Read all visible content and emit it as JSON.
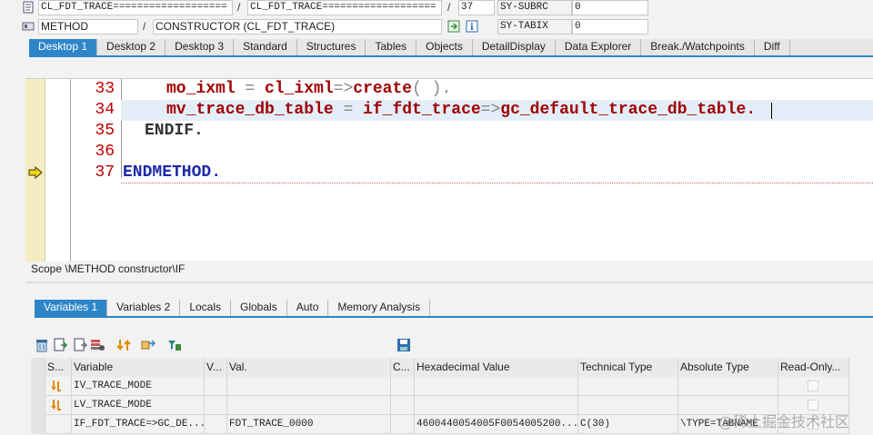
{
  "header": {
    "row1": {
      "field1": "CL_FDT_TRACE===================",
      "sep1": "/",
      "field2": "CL_FDT_TRACE===================",
      "sep2": "/",
      "line_no": "37",
      "sys_label": "SY-SUBRC",
      "sys_value": "0"
    },
    "row2": {
      "type": "METHOD",
      "sep": "/",
      "name": "CONSTRUCTOR (CL_FDT_TRACE)",
      "sys_label": "SY-TABIX",
      "sys_value": "0"
    }
  },
  "desktop_tabs": [
    "Desktop 1",
    "Desktop 2",
    "Desktop 3",
    "Standard",
    "Structures",
    "Tables",
    "Objects",
    "DetailDisplay",
    "Data Explorer",
    "Break./Watchpoints",
    "Diff"
  ],
  "editor": {
    "lines": [
      {
        "num": "33",
        "tokens": [
          {
            "t": "mo_ixml",
            "c": "c-red"
          },
          {
            "t": " = ",
            "c": "c-gray"
          },
          {
            "t": "cl_ixml",
            "c": "c-red"
          },
          {
            "t": "=>",
            "c": "c-gray"
          },
          {
            "t": "create",
            "c": "c-red"
          },
          {
            "t": "( ).",
            "c": "c-gray"
          }
        ]
      },
      {
        "num": "34",
        "tokens": [
          {
            "t": "mv_trace_db_table",
            "c": "c-red"
          },
          {
            "t": " = ",
            "c": "c-gray"
          },
          {
            "t": "if_fdt_trace",
            "c": "c-red"
          },
          {
            "t": "=>",
            "c": "c-gray"
          },
          {
            "t": "gc_default_trace_db_table.",
            "c": "c-red"
          }
        ]
      },
      {
        "num": "35",
        "tokens": [
          {
            "t": "ENDIF.",
            "c": "c-dark"
          }
        ]
      },
      {
        "num": "36",
        "tokens": []
      },
      {
        "num": "37",
        "tokens": [
          {
            "t": "ENDMETHOD.",
            "c": "c-blue"
          }
        ]
      }
    ]
  },
  "scope": "Scope \\METHOD constructor\\IF",
  "var_tabs": [
    "Variables 1",
    "Variables 2",
    "Locals",
    "Globals",
    "Auto",
    "Memory Analysis"
  ],
  "grid": {
    "columns": [
      "S...",
      "Variable",
      "V...",
      "Val.",
      "C...",
      "Hexadecimal Value",
      "Technical Type",
      "Absolute Type",
      "Read-Only..."
    ],
    "rows": [
      {
        "variable": "IV_TRACE_MODE",
        "val": "",
        "hex": "",
        "tech": "",
        "abs": ""
      },
      {
        "variable": "LV_TRACE_MODE",
        "val": "",
        "hex": "",
        "tech": "",
        "abs": ""
      },
      {
        "variable": "IF_FDT_TRACE=>GC_DE...",
        "val": "FDT_TRACE_0000",
        "hex": "4600440054005F0054005200...",
        "tech": "C(30)",
        "abs": "\\TYPE=TABNAME"
      }
    ]
  },
  "watermark": "@稀土掘金技术社区",
  "colors": {
    "accent": "#2e86c9",
    "keyword": "#1e2aa8",
    "identifier": "#a00000",
    "line_number": "#c00000",
    "gutter": "#f4ecc2"
  }
}
